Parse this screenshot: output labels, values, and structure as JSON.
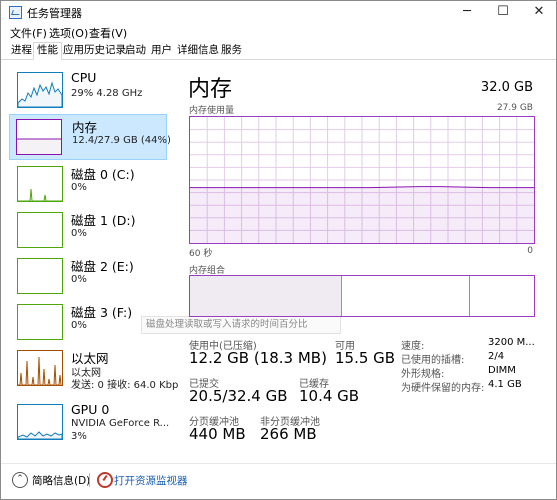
{
  "window": {
    "title": "任务管理器",
    "min": "─",
    "max": "☐",
    "close": "✕"
  },
  "menu": [
    "文件(F)",
    "选项(O)",
    "查看(V)"
  ],
  "tabs": [
    "进程",
    "性能",
    "应用历史记录",
    "启动",
    "用户",
    "详细信息",
    "服务"
  ],
  "active_tab": "性能",
  "sidebar": {
    "items": [
      {
        "title": "CPU",
        "sub": "29% 4.28 GHz",
        "sub2": "",
        "color": "#117dbb",
        "fill": "#f1f6fa"
      },
      {
        "title": "内存",
        "sub": "12.4/27.9 GB (44%)",
        "sub2": "",
        "color": "#8b12ae",
        "fill": "#f4f2f4"
      },
      {
        "title": "磁盘 0 (C:)",
        "sub": "0%",
        "sub2": "",
        "color": "#4da60c",
        "fill": "#eff7e9"
      },
      {
        "title": "磁盘 1 (D:)",
        "sub": "0%",
        "sub2": "",
        "color": "#4da60c",
        "fill": "#eff7e9"
      },
      {
        "title": "磁盘 2 (E:)",
        "sub": "0%",
        "sub2": "",
        "color": "#4da60c",
        "fill": "#eff7e9"
      },
      {
        "title": "磁盘 3 (F:)",
        "sub": "0%",
        "sub2": "",
        "color": "#4da60c",
        "fill": "#eff7e9"
      },
      {
        "title": "以太网",
        "sub": "以太网",
        "sub2": "发送: 0 接收: 64.0 Kbp",
        "color": "#a74f01",
        "fill": "#fcf3eb"
      },
      {
        "title": "GPU 0",
        "sub": "NVIDIA GeForce R...",
        "sub2": "3%",
        "color": "#117dbb",
        "fill": "#f1f6fa"
      }
    ]
  },
  "tooltip": "磁盘处理读取或写入请求的时间百分比",
  "main": {
    "title": "内存",
    "total": "32.0 GB",
    "usage_label": "内存使用量",
    "usage_max": "27.9 GB",
    "axis_left": "60 秒",
    "axis_right": "0",
    "composition_label": "内存组合",
    "usage_level": 0.44,
    "composition_segments": [
      0.44,
      0.37,
      0.19
    ]
  },
  "stats": {
    "in_use_label": "使用中(已压缩)",
    "in_use_value": "12.2 GB (18.3 MB)",
    "available_label": "可用",
    "available_value": "15.5 GB",
    "committed_label": "已提交",
    "committed_value": "20.5/32.4 GB",
    "cached_label": "已缓存",
    "cached_value": "10.4 GB",
    "paged_label": "分页缓冲池",
    "paged_value": "440 MB",
    "nonpaged_label": "非分页缓冲池",
    "nonpaged_value": "266 MB"
  },
  "specs": [
    {
      "label": "速度:",
      "value": "3200 M..."
    },
    {
      "label": "已使用的插槽:",
      "value": "2/4"
    },
    {
      "label": "外形规格:",
      "value": "DIMM"
    },
    {
      "label": "为硬件保留的内存:",
      "value": "4.1 GB"
    }
  ],
  "footer": {
    "fewer": "简略信息(D)",
    "fewer_icon": "chevron-up-icon",
    "monitor": "打开资源监视器"
  }
}
